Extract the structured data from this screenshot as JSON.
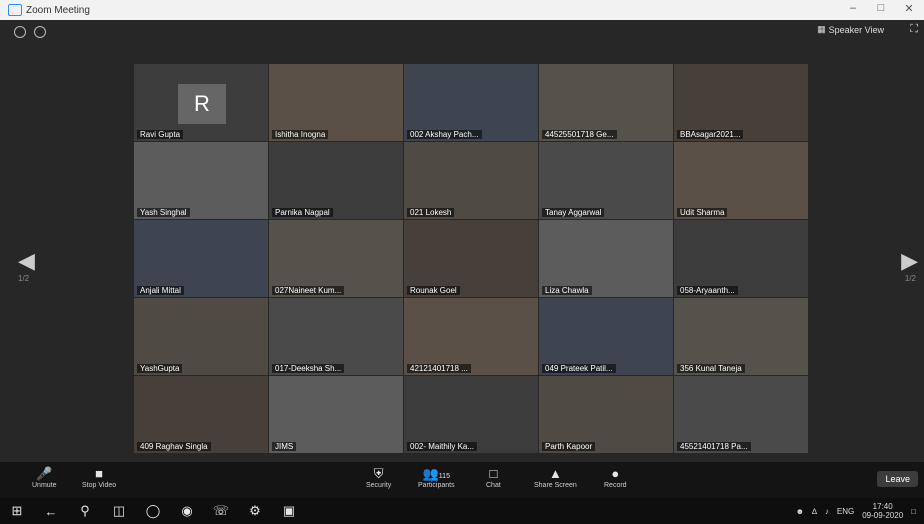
{
  "window": {
    "title": "Zoom Meeting"
  },
  "view": {
    "speaker_view_label": "Speaker View",
    "page_left": "1/2",
    "page_right": "1/2"
  },
  "participants": [
    {
      "name": "Ravi Gupta",
      "initial": "R",
      "active": true
    },
    {
      "name": "Ishitha Inogna"
    },
    {
      "name": "002 Akshay Pach..."
    },
    {
      "name": "44525501718 Ge..."
    },
    {
      "name": "BBAsagar2021..."
    },
    {
      "name": "Yash Singhal"
    },
    {
      "name": "Parnika Nagpal"
    },
    {
      "name": "021 Lokesh"
    },
    {
      "name": "Tanay Aggarwal"
    },
    {
      "name": "Udit Sharma"
    },
    {
      "name": "Anjali Mittal"
    },
    {
      "name": "027Naineet Kum..."
    },
    {
      "name": "Rounak Goel"
    },
    {
      "name": "Liza Chawla"
    },
    {
      "name": "058-Aryaanth..."
    },
    {
      "name": "YashGupta"
    },
    {
      "name": "017-Deeksha Sh..."
    },
    {
      "name": "42121401718 ..."
    },
    {
      "name": "049 Prateek Patil..."
    },
    {
      "name": "356 Kunal Taneja"
    },
    {
      "name": "409 Raghav Singla"
    },
    {
      "name": "JIMS"
    },
    {
      "name": "002- Maithily Ka..."
    },
    {
      "name": "Parth Kapoor"
    },
    {
      "name": "45521401718 Pa..."
    }
  ],
  "controls": {
    "unmute": "Unmute",
    "stop_video": "Stop Video",
    "security": "Security",
    "participants": "Participants",
    "participants_count": "115",
    "chat": "Chat",
    "share_screen": "Share Screen",
    "record": "Record",
    "leave": "Leave"
  },
  "taskbar": {
    "time": "17:40",
    "date": "09-09-2020",
    "lang": "ENG"
  },
  "colors": {
    "active_border": "#e8e8e8",
    "bar": "#141414",
    "grid_bg": "#272727"
  }
}
